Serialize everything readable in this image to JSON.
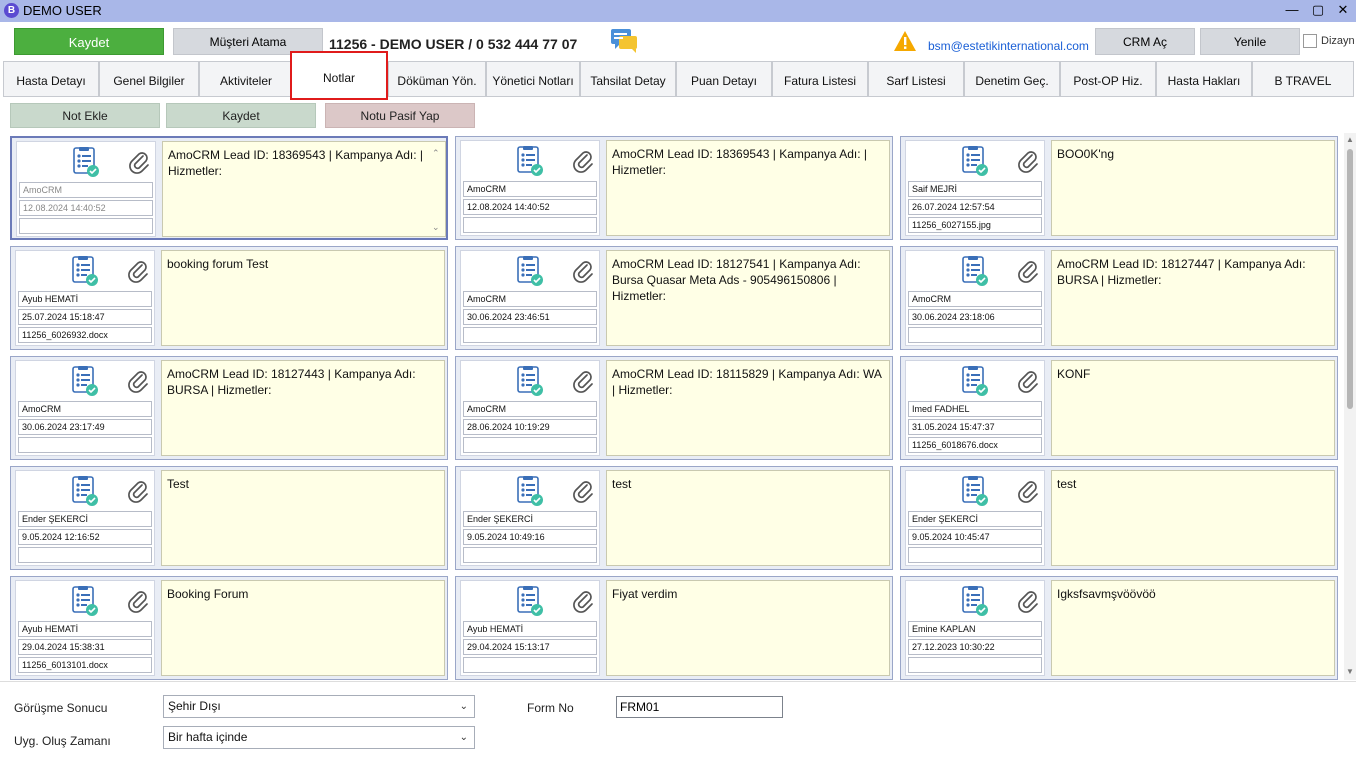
{
  "window": {
    "title": "DEMO USER",
    "logo": "B"
  },
  "topbar": {
    "save_label": "Kaydet",
    "assign_label": "Müşteri Atama",
    "patient_info": "11256  -  DEMO USER  /  0 532 444 77 07",
    "email": "bsm@estetikinternational.com",
    "crm_label": "CRM Aç",
    "refresh_label": "Yenile",
    "design_label": "Dizayn"
  },
  "tabs": [
    "Hasta Detayı",
    "Genel Bilgiler",
    "Aktiviteler",
    "Notlar",
    "Döküman Yön.",
    "Yönetici Notları",
    "Tahsilat Detay",
    "Puan Detayı",
    "Fatura Listesi",
    "Sarf Listesi",
    "Denetim Geç.",
    "Post-OP Hiz.",
    "Hasta Hakları",
    "B TRAVEL"
  ],
  "active_tab": "Notlar",
  "actions": {
    "add": "Not Ekle",
    "save": "Kaydet",
    "deactivate": "Notu Pasif Yap"
  },
  "notes": [
    {
      "user": "AmoCRM",
      "date": "12.08.2024 14:40:52",
      "file": "",
      "text": "AmoCRM Lead ID: 18369543 | Kampanya Adı:  | Hizmetler:"
    },
    {
      "user": "AmoCRM",
      "date": "12.08.2024 14:40:52",
      "file": "",
      "text": "AmoCRM Lead ID: 18369543 | Kampanya Adı:  | Hizmetler:"
    },
    {
      "user": "Saif MEJRİ",
      "date": "26.07.2024 12:57:54",
      "file": "11256_6027155.jpg",
      "text": "BOO0K'ng"
    },
    {
      "user": "Ayub HEMATİ",
      "date": "25.07.2024 15:18:47",
      "file": "11256_6026932.docx",
      "text": "booking forum  Test"
    },
    {
      "user": "AmoCRM",
      "date": "30.06.2024 23:46:51",
      "file": "",
      "text": "AmoCRM Lead ID: 18127541 | Kampanya Adı: Bursa Quasar Meta Ads - 905496150806  | Hizmetler:"
    },
    {
      "user": "AmoCRM",
      "date": "30.06.2024 23:18:06",
      "file": "",
      "text": "AmoCRM Lead ID: 18127447 | Kampanya Adı: BURSA  | Hizmetler:"
    },
    {
      "user": "AmoCRM",
      "date": "30.06.2024 23:17:49",
      "file": "",
      "text": "AmoCRM Lead ID: 18127443 | Kampanya Adı: BURSA  | Hizmetler:"
    },
    {
      "user": "AmoCRM",
      "date": "28.06.2024 10:19:29",
      "file": "",
      "text": "AmoCRM Lead ID: 18115829 | Kampanya Adı: WA  | Hizmetler:"
    },
    {
      "user": "Imed FADHEL",
      "date": "31.05.2024 15:47:37",
      "file": "11256_6018676.docx",
      "text": "KONF"
    },
    {
      "user": "Ender ŞEKERCİ",
      "date": "9.05.2024 12:16:52",
      "file": "",
      "text": "Test"
    },
    {
      "user": "Ender ŞEKERCİ",
      "date": "9.05.2024 10:49:16",
      "file": "",
      "text": "test"
    },
    {
      "user": "Ender ŞEKERCİ",
      "date": "9.05.2024 10:45:47",
      "file": "",
      "text": "test"
    },
    {
      "user": "Ayub HEMATİ",
      "date": "29.04.2024 15:38:31",
      "file": "11256_6013101.docx",
      "text": "Booking Forum"
    },
    {
      "user": "Ayub HEMATİ",
      "date": "29.04.2024 15:13:17",
      "file": "",
      "text": "Fiyat verdim"
    },
    {
      "user": "Emine KAPLAN",
      "date": "27.12.2023 10:30:22",
      "file": "",
      "text": "Igksfsavmşvöövöö"
    }
  ],
  "form": {
    "result_label": "Görüşme Sonucu",
    "result_value": "Şehir Dışı",
    "time_label": "Uyg. Oluş Zamanı",
    "time_value": "Bir hafta içinde",
    "form_no_label": "Form No",
    "form_no_value": "FRM01"
  },
  "icons": {
    "doc": "document-checklist-icon",
    "clip": "paperclip-icon",
    "warn": "warning-icon",
    "chat": "chat-icon"
  },
  "colors": {
    "primary_green": "#4caf3f",
    "titlebar": "#a9b7e8",
    "note_bg": "#ffffe6",
    "active_tab_border": "#e01b1b",
    "email": "#1a5fd6"
  }
}
